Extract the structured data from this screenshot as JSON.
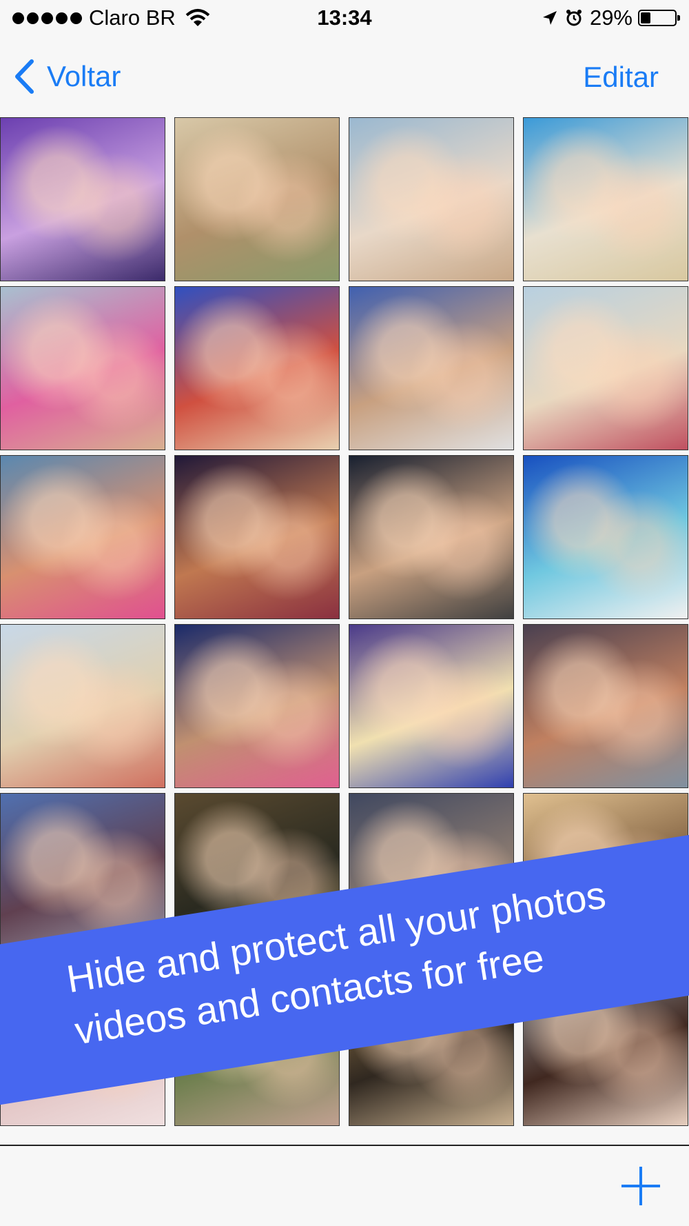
{
  "status_bar": {
    "carrier": "Claro BR",
    "time": "13:34",
    "battery": "29%",
    "battery_level": 0.29
  },
  "nav": {
    "back_label": "Voltar",
    "edit_label": "Editar",
    "accent_color": "#1a7cf5"
  },
  "photos": [
    {
      "colors": [
        "#6b3fb0",
        "#c9a0e0",
        "#3b2a6a"
      ]
    },
    {
      "colors": [
        "#d8c8a8",
        "#b0906a",
        "#8a9a6a"
      ]
    },
    {
      "colors": [
        "#9ab8d0",
        "#e8d8c8",
        "#c8a888"
      ]
    },
    {
      "colors": [
        "#3a9ad8",
        "#e8e0d0",
        "#d8c8a0"
      ]
    },
    {
      "colors": [
        "#a8c0d0",
        "#e060a0",
        "#d8b090"
      ]
    },
    {
      "colors": [
        "#3050c0",
        "#d05040",
        "#e8d0b0"
      ]
    },
    {
      "colors": [
        "#4060b0",
        "#c8a080",
        "#e0e0e0"
      ]
    },
    {
      "colors": [
        "#b8d0e0",
        "#e8d8c0",
        "#c05060"
      ]
    },
    {
      "colors": [
        "#5a88b0",
        "#d89070",
        "#e05090"
      ]
    },
    {
      "colors": [
        "#201838",
        "#c07850",
        "#8a3040"
      ]
    },
    {
      "colors": [
        "#182030",
        "#c8a080",
        "#404040"
      ]
    },
    {
      "colors": [
        "#1850c0",
        "#70c8e0",
        "#f0f0f0"
      ]
    },
    {
      "colors": [
        "#c8d8e8",
        "#e0d0b0",
        "#d07060"
      ]
    },
    {
      "colors": [
        "#1a2a6a",
        "#c09070",
        "#e06090"
      ]
    },
    {
      "colors": [
        "#4a3a8a",
        "#f0e0b0",
        "#3040b0"
      ]
    },
    {
      "colors": [
        "#4a4050",
        "#c08060",
        "#8090a0"
      ]
    },
    {
      "colors": [
        "#5070b0",
        "#604050",
        "#a0a0b0"
      ]
    },
    {
      "colors": [
        "#5a4a30",
        "#2a2a20",
        "#8a7a50"
      ]
    },
    {
      "colors": [
        "#404860",
        "#8a7a70",
        "#c09070"
      ]
    },
    {
      "colors": [
        "#e0c090",
        "#806040",
        "#c8a070"
      ]
    },
    {
      "colors": [
        "#c8b8b8",
        "#e0c0c0",
        "#f0e0e0"
      ]
    },
    {
      "colors": [
        "#3a4a30",
        "#708050",
        "#c0a090"
      ]
    },
    {
      "colors": [
        "#a08050",
        "#302820",
        "#c8b090"
      ]
    },
    {
      "colors": [
        "#a0a8b0",
        "#402820",
        "#e8d0c0"
      ]
    }
  ],
  "promo": {
    "line1": "Hide and protect all your photos",
    "line2": "videos and contacts for free",
    "color": "#4767f0"
  },
  "toolbar": {
    "add_icon": "plus-icon"
  }
}
